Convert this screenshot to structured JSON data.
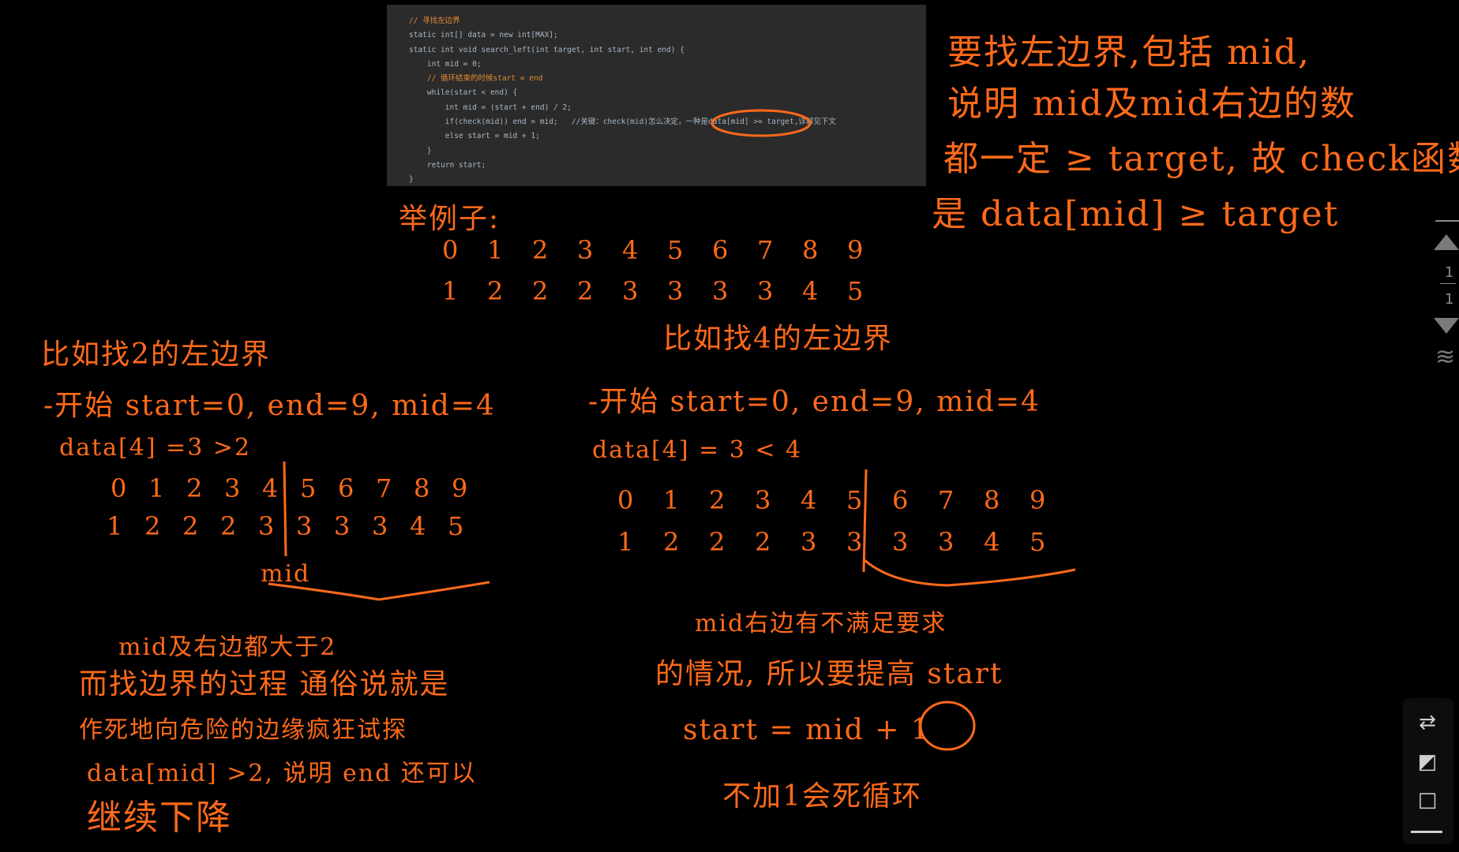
{
  "code": {
    "lines": [
      {
        "text": "// 寻找左边界",
        "kind": "comment"
      },
      {
        "text": "static int[] data = new int[MAX];",
        "kind": "code"
      },
      {
        "text": "static int void search_left(int target, int start, int end) {",
        "kind": "code"
      },
      {
        "text": "    int mid = 0;",
        "kind": "code"
      },
      {
        "text": "    // 循环结束的时候start = end",
        "kind": "comment"
      },
      {
        "text": "    while(start < end) {",
        "kind": "code"
      },
      {
        "text": "        int mid = (start + end) / 2;",
        "kind": "code"
      },
      {
        "text": "        if(check(mid)) end = mid;   //关键：check(mid)怎么决定，一种是data[mid] >= target,详解见下文",
        "kind": "code"
      },
      {
        "text": "        else start = mid + 1;",
        "kind": "code"
      },
      {
        "text": "    }",
        "kind": "code"
      },
      {
        "text": "    return start;",
        "kind": "code"
      },
      {
        "text": "}",
        "kind": "code"
      }
    ]
  },
  "notes": {
    "top_right_1": "要找左边界,包括 mid,",
    "top_right_2": "说明 mid及mid右边的数",
    "top_right_3": "都一定 ≥ target, 故 check函数",
    "top_right_4": "是 data[mid] ≥ target",
    "example_title": "举例子:",
    "left_title": "比如找2的左边界",
    "left_init": "-开始  start=0, end=9, mid=4",
    "left_cmp": "data[4] =3 >2",
    "left_mid_label": "mid",
    "left_note1": "mid及右边都大于2",
    "left_note2": "而找边界的过程 通俗说就是",
    "left_note3": "作死地向危险的边缘疯狂试探",
    "left_note4": "data[mid] >2, 说明 end 还可以",
    "left_note5": "继续下降",
    "right_title": "比如找4的左边界",
    "right_init": "-开始  start=0, end=9, mid=4",
    "right_cmp": "data[4] = 3 < 4",
    "right_note1": "mid右边有不满足要求",
    "right_note2": "的情况, 所以要提高 start",
    "right_note3": "start = mid + 1",
    "right_note4": "不加1会死循环"
  },
  "example": {
    "indices": [
      "0",
      "1",
      "2",
      "3",
      "4",
      "5",
      "6",
      "7",
      "8",
      "9"
    ],
    "values": [
      "1",
      "2",
      "2",
      "2",
      "3",
      "3",
      "3",
      "3",
      "4",
      "5"
    ]
  },
  "side_toolbar": {
    "page_current": "1",
    "page_total": "1"
  },
  "icons": {
    "up": "chevron-up-icon",
    "down": "chevron-down-icon",
    "layers": "layers-icon",
    "swap": "swap-icon",
    "crop": "crop-icon",
    "square": "square-icon"
  }
}
